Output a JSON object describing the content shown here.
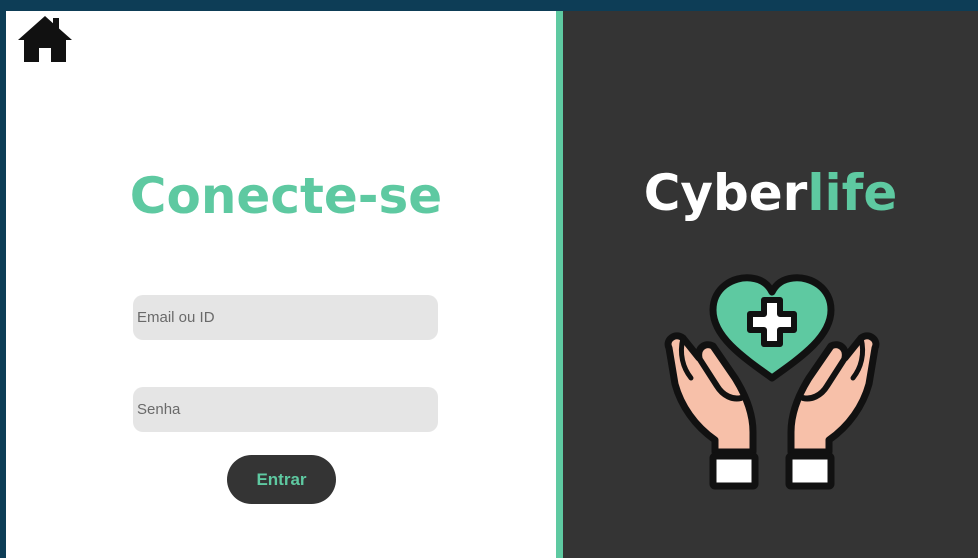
{
  "login": {
    "title": "Conecte-se",
    "email_placeholder": "Email ou ID",
    "password_placeholder": "Senha",
    "submit_label": "Entrar",
    "home_icon": "home-icon"
  },
  "brand": {
    "name_part1": "Cyber",
    "name_part2": "life",
    "logo_icon": "hands-heart-cross-icon"
  },
  "colors": {
    "accent": "#5ec9a1",
    "dark_panel": "#343434",
    "page_border": "#0d3d56",
    "input_bg": "#e5e5e5"
  }
}
